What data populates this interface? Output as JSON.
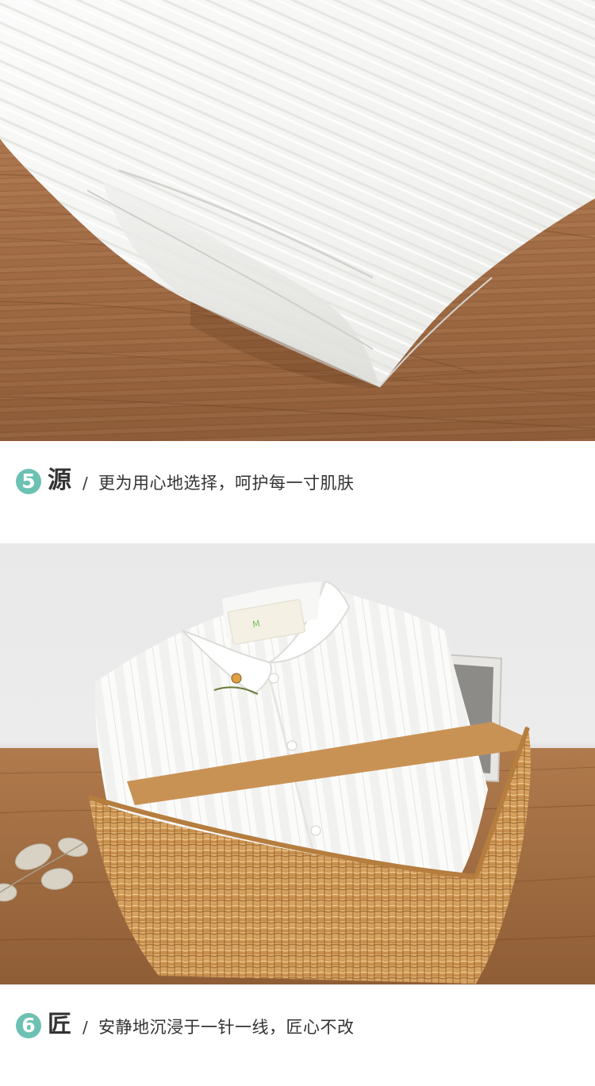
{
  "photos": [
    {
      "icon": "fabric-hem-photo",
      "subject": "white seersucker fabric hem on wooden table"
    },
    {
      "icon": "shirt-basket-photo",
      "subject": "folded white shirt in wicker basket"
    }
  ],
  "sections": [
    {
      "number": "5",
      "title": "源",
      "slash": "/",
      "description": "更为用心地选择，呵护每一寸肌肤"
    },
    {
      "number": "6",
      "title": "匠",
      "slash": "/",
      "description": "安静地沉浸于一针一线，匠心不改"
    }
  ],
  "colors": {
    "accent": "#6cc1b2",
    "text": "#333333",
    "wood": "#a8724a",
    "fabric": "#f7f7f5",
    "wicker": "#d9a866"
  }
}
